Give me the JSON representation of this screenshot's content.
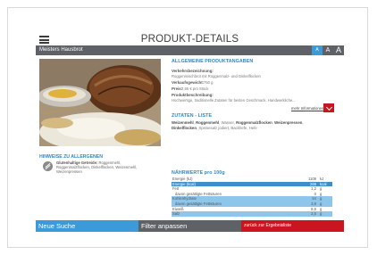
{
  "header": {
    "title": "PRODUKT-DETAILS",
    "shop_name": "Meisters Hausbrot",
    "font_sizes": [
      "A",
      "A",
      "A"
    ]
  },
  "allergens": {
    "heading": "HINWEISE ZU ALLERGENEN",
    "label": "Glutenhaltige Getreide:",
    "text": "Roggenmehl, Roggenmalzflocken, Dinkelflocken, Weizenmehl, Weizenpressen"
  },
  "product": {
    "section_title": "ALLGEMEINE PRODUKTANGABEN",
    "fields": {
      "name_label": "Verkehrsbezeichnung:",
      "name_value": "Roggenmischbrot mit Roggenmalz- und Dinkelflocken",
      "weight_label": "Verkaufsgewicht:",
      "weight_value": "750 g",
      "price_label": "Preis:",
      "price_value": "2,95 € pro Stück",
      "desc_label": "Produktbeschreibung:",
      "desc_value": "Hochwertige, traditionelle Zutaten für besten Geschmack. Handwerkliche..."
    },
    "more_link": "mehr Informationen"
  },
  "ingredients": {
    "title": "ZUTATEN - LISTE",
    "items": [
      {
        "text": "Weizenmehl",
        "bold": true
      },
      {
        "text": ", ",
        "bold": false
      },
      {
        "text": "Roggenmehl",
        "bold": true
      },
      {
        "text": ", Wasser, ",
        "bold": false
      },
      {
        "text": "Roggenmalzflocken",
        "bold": true
      },
      {
        "text": ", ",
        "bold": false
      },
      {
        "text": "Weizenpressen",
        "bold": true
      },
      {
        "text": ", ",
        "bold": false
      },
      {
        "text": "Dinkelflocken",
        "bold": true
      },
      {
        "text": ", Speisesalz jodiert, Backhefe, Hefe",
        "bold": false
      }
    ]
  },
  "nutrition": {
    "title": "NÄHRWERTE pro 100g",
    "rows": [
      {
        "name": "Energie (kJ)",
        "value": "1109",
        "unit": "kJ",
        "style": "plain"
      },
      {
        "name": "Energie (kcal)",
        "value": "269",
        "unit": "kcal",
        "style": "dark"
      },
      {
        "name": "Fett",
        "value": "1,2",
        "unit": "g",
        "style": "plain"
      },
      {
        "name": "davon gesättigte Fettsäuren",
        "value": "0",
        "unit": "g",
        "style": "plain"
      },
      {
        "name": "Kohlenhydrate",
        "value": "54",
        "unit": "g",
        "style": "hl"
      },
      {
        "name": "davon gesättigte Fettsäuren",
        "value": "3,9",
        "unit": "g",
        "style": "hl"
      },
      {
        "name": "Eiweiß",
        "value": "8,6",
        "unit": "g",
        "style": "plain"
      },
      {
        "name": "Salz",
        "value": "2,5",
        "unit": "g",
        "style": "hl"
      }
    ]
  },
  "bottom_nav": {
    "new_search": "Neue Suche",
    "filter": "Filter anpassen",
    "back": "zurück zur Ergebnisliste"
  },
  "colors": {
    "accent_blue": "#3d9ad8",
    "dark_gray": "#5e6266",
    "red": "#c8151f",
    "highlight": "#8ec5ea"
  }
}
